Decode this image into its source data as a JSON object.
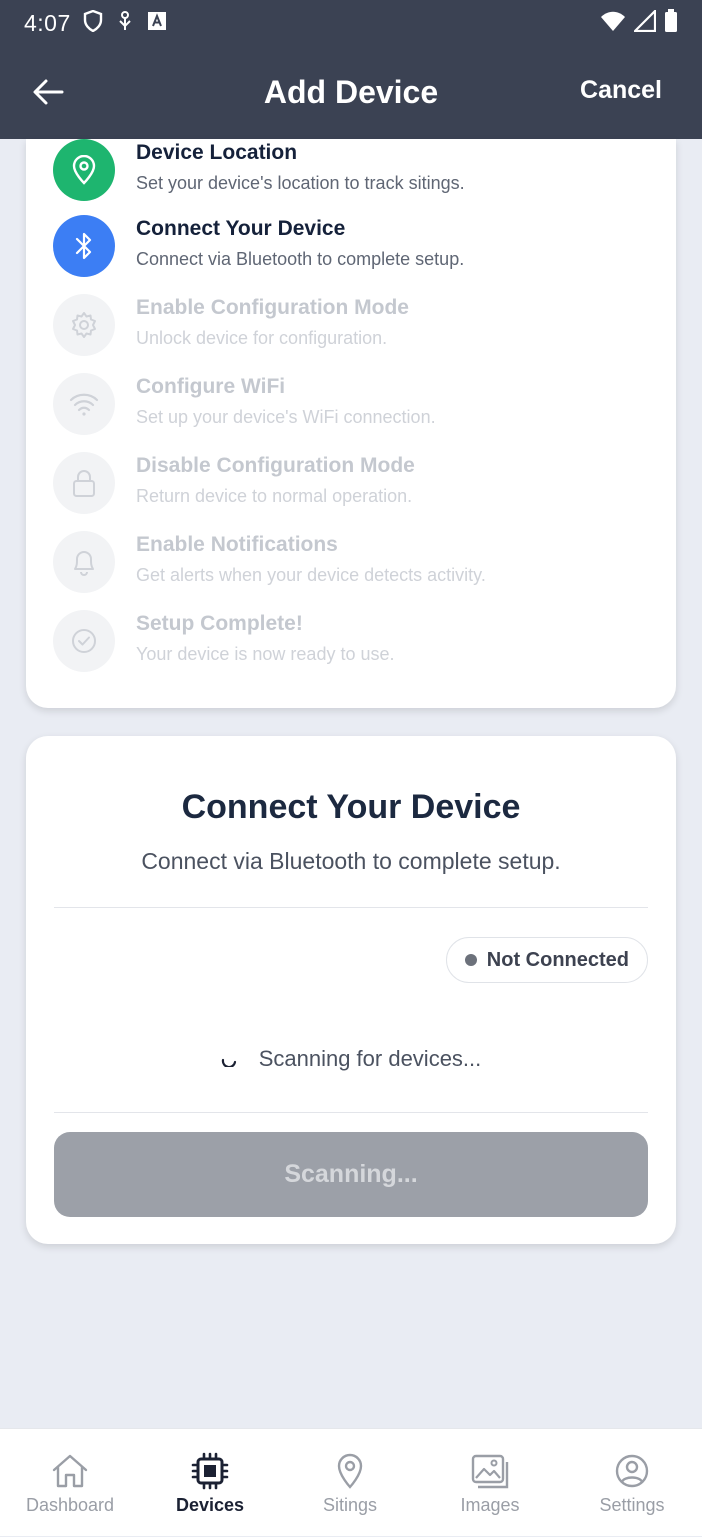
{
  "status_bar": {
    "time": "4:07"
  },
  "header": {
    "title": "Add Device",
    "cancel_label": "Cancel"
  },
  "steps": [
    {
      "title": "Device Location",
      "subtitle": "Set your device's location to track sitings.",
      "state": "done",
      "icon": "location-pin-icon"
    },
    {
      "title": "Connect Your Device",
      "subtitle": "Connect via Bluetooth to complete setup.",
      "state": "active",
      "icon": "bluetooth-icon"
    },
    {
      "title": "Enable Configuration Mode",
      "subtitle": "Unlock device for configuration.",
      "state": "pending",
      "icon": "gear-icon"
    },
    {
      "title": "Configure WiFi",
      "subtitle": "Set up your device's WiFi connection.",
      "state": "pending",
      "icon": "wifi-icon"
    },
    {
      "title": "Disable Configuration Mode",
      "subtitle": "Return device to normal operation.",
      "state": "pending",
      "icon": "lock-icon"
    },
    {
      "title": "Enable Notifications",
      "subtitle": "Get alerts when your device detects activity.",
      "state": "pending",
      "icon": "bell-icon"
    },
    {
      "title": "Setup Complete!",
      "subtitle": "Your device is now ready to use.",
      "state": "pending",
      "icon": "check-circle-icon"
    }
  ],
  "connect": {
    "title": "Connect Your Device",
    "subtitle": "Connect via Bluetooth to complete setup.",
    "status": "Not Connected",
    "scan_text": "Scanning for devices...",
    "button_label": "Scanning..."
  },
  "nav": {
    "items": [
      {
        "label": "Dashboard",
        "icon": "home-icon"
      },
      {
        "label": "Devices",
        "icon": "chip-icon"
      },
      {
        "label": "Sitings",
        "icon": "location-pin-icon"
      },
      {
        "label": "Images",
        "icon": "images-icon"
      },
      {
        "label": "Settings",
        "icon": "user-circle-icon"
      }
    ],
    "active": "Devices"
  },
  "colors": {
    "header_bg": "#3b4253",
    "step_done": "#1eb56f",
    "step_active": "#3c7ef4",
    "button_disabled": "#9ca0a8",
    "page_bg": "#e9ecf3"
  }
}
